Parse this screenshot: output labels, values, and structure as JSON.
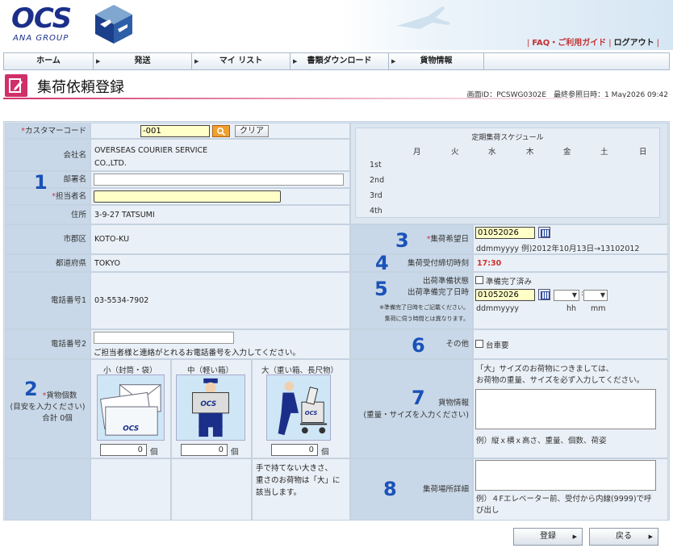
{
  "header": {
    "logo_text": "OCS",
    "logo_sub": "ANA GROUP",
    "links": [
      {
        "label": "FAQ・ご利用ガイド"
      },
      {
        "label": "ログアウト"
      }
    ],
    "sep": "|"
  },
  "nav": [
    {
      "label": "ホーム"
    },
    {
      "label": "発送"
    },
    {
      "label": "マイ リスト"
    },
    {
      "label": "書類ダウンロード"
    },
    {
      "label": "貨物情報"
    }
  ],
  "page": {
    "title": "集荷依頼登録",
    "screen_info": "画面ID：PCSWG0302E　最終参照日時：1 May2026 09:42"
  },
  "form": {
    "customer_code": {
      "label": "カスタマーコード",
      "value": "-001",
      "clear": "クリア"
    },
    "company": {
      "label": "会社名",
      "value_1": "OVERSEAS COURIER SERVICE",
      "value_2": "CO.,LTD."
    },
    "dept": {
      "label": "部署名",
      "value": ""
    },
    "person": {
      "label": "担当者名",
      "value": ""
    },
    "address": {
      "label": "住所",
      "value": "3-9-27 TATSUMI"
    },
    "city": {
      "label": "市郡区",
      "value": "KOTO-KU"
    },
    "pref": {
      "label": "都道府県",
      "value": "TOKYO"
    },
    "phone1": {
      "label": "電話番号1",
      "value": "03-5534-7902"
    },
    "phone2": {
      "label": "電話番号2",
      "value": "",
      "hint": "ご担当者様と連絡がとれるお電話番号を入力してください。"
    },
    "pieces": {
      "label": "貨物個数",
      "sub": "(目安を入力ください)",
      "total": "合計 0個",
      "sizes": [
        {
          "label": "小（封筒・袋）",
          "qty": "0",
          "unit": "個"
        },
        {
          "label": "中（軽い箱）",
          "qty": "0",
          "unit": "個"
        },
        {
          "label": "大（重い箱、長尺物）",
          "qty": "0",
          "unit": "個"
        }
      ],
      "note_1": "手で持てない大きさ、",
      "note_2": "重さのお荷物は「大」に",
      "note_3": "該当します。"
    },
    "schedule": {
      "title": "定期集荷スケジュール",
      "days": [
        "月",
        "火",
        "水",
        "木",
        "金",
        "土",
        "日"
      ],
      "weeks": [
        "1st",
        "2nd",
        "3rd",
        "4th"
      ]
    },
    "pickup_date": {
      "label": "集荷希望日",
      "value": "01052026",
      "hint": "ddmmyyyy 例)2012年10月13日→13102012"
    },
    "cutoff": {
      "label": "集荷受付締切時刻",
      "value": "17:30"
    },
    "ready": {
      "status_label": "出荷準備状態",
      "checkbox": "準備完了済み",
      "datetime_label": "出荷準備完了日時",
      "value": "01052026",
      "fmt": "ddmmyyyy",
      "hh": "hh",
      "mm": "mm",
      "note_1": "※準備完了日時をご記載ください。",
      "note_2": "集荷に伺う時間とは異なります。"
    },
    "other": {
      "label": "その他",
      "checkbox": "台車要"
    },
    "cargo": {
      "label": "貨物情報",
      "sub": "(重量・サイズを入力ください)",
      "hint_1": "「大」サイズのお荷物につきましては、",
      "hint_2": "お荷物の重量、サイズを必ず入力してください。",
      "example": "例）縦ｘ横ｘ高さ、重量、個数、荷姿"
    },
    "place": {
      "label": "集荷場所詳細",
      "example_1": "例）４Fエレベーター前、受付から内線(9999)で呼",
      "example_2": "び出し"
    },
    "numbers": [
      "1",
      "2",
      "3",
      "4",
      "5",
      "6",
      "7",
      "8"
    ]
  },
  "buttons": {
    "register": "登録",
    "back": "戻る"
  },
  "colors": {
    "brand": "#1b2f8a",
    "accent": "#d0306a",
    "label_bg": "#c9d8e8",
    "highlight": "#ffffc8"
  }
}
